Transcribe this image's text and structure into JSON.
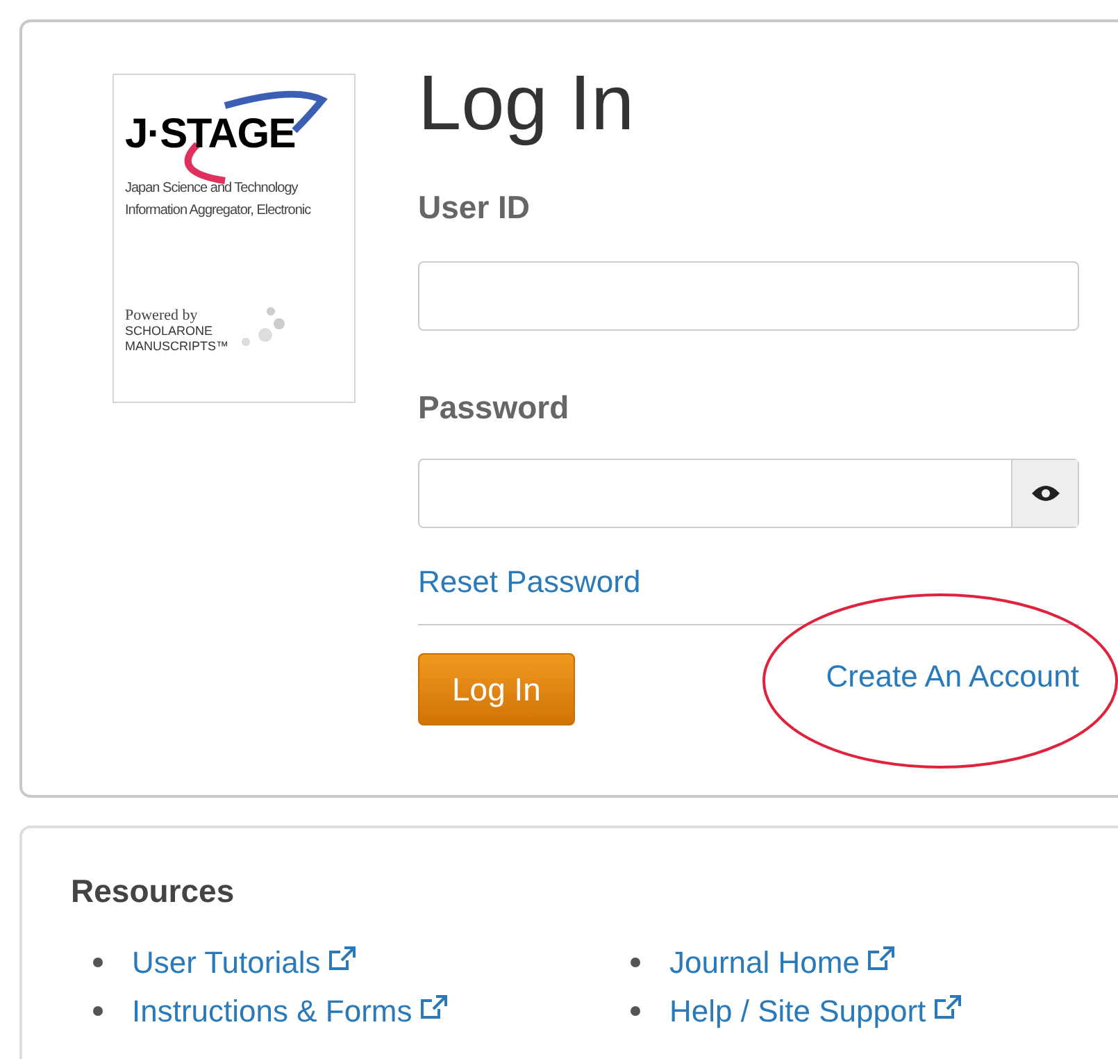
{
  "logo": {
    "brand": "J·STAGE",
    "lines": [
      "Japan Science and Technology",
      "Information Aggregator, Electronic"
    ],
    "powered_by": "Powered by",
    "vendor": [
      "SCHOLARONE",
      "MANUSCRIPTS™"
    ]
  },
  "title": "Log In",
  "fields": [
    {
      "label": "User ID",
      "kind": "text"
    },
    {
      "label": "Password",
      "kind": "password"
    }
  ],
  "reset_link": "Reset Password",
  "login_button": "Log In",
  "create_account": {
    "label": "Create An Account",
    "circled": true
  },
  "resources": {
    "title": "Resources",
    "columns": [
      [
        "User Tutorials",
        "Instructions & Forms"
      ],
      [
        "Journal Home",
        "Help / Site Support"
      ]
    ]
  }
}
